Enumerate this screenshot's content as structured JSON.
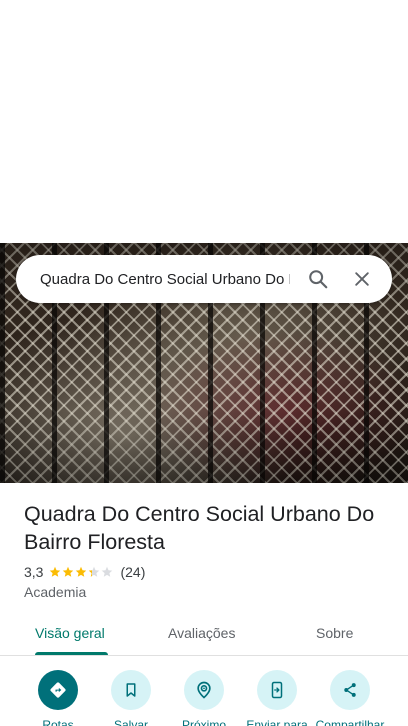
{
  "search": {
    "query": "Quadra Do Centro Social Urbano Do Bairro Floresta"
  },
  "place": {
    "title": "Quadra Do Centro Social Urbano Do Bairro Floresta",
    "rating": "3,3",
    "rating_value": 3.3,
    "rating_max": 5,
    "review_count": "(24)",
    "category": "Academia"
  },
  "tabs": [
    {
      "label": "Visão geral",
      "active": true
    },
    {
      "label": "Avaliações",
      "active": false
    },
    {
      "label": "Sobre",
      "active": false
    }
  ],
  "actions": [
    {
      "label": "Rotas",
      "icon": "directions-icon"
    },
    {
      "label": "Salvar",
      "icon": "bookmark-icon"
    },
    {
      "label": "Próximo",
      "icon": "nearby-icon"
    },
    {
      "label": "Enviar para",
      "icon": "send-to-phone-icon"
    },
    {
      "label": "Compartilhar",
      "icon": "share-icon"
    }
  ],
  "colors": {
    "accent": "#00796b",
    "action_primary": "#00707a",
    "action_bg": "#d6f3f6",
    "star": "#fbbc04"
  }
}
